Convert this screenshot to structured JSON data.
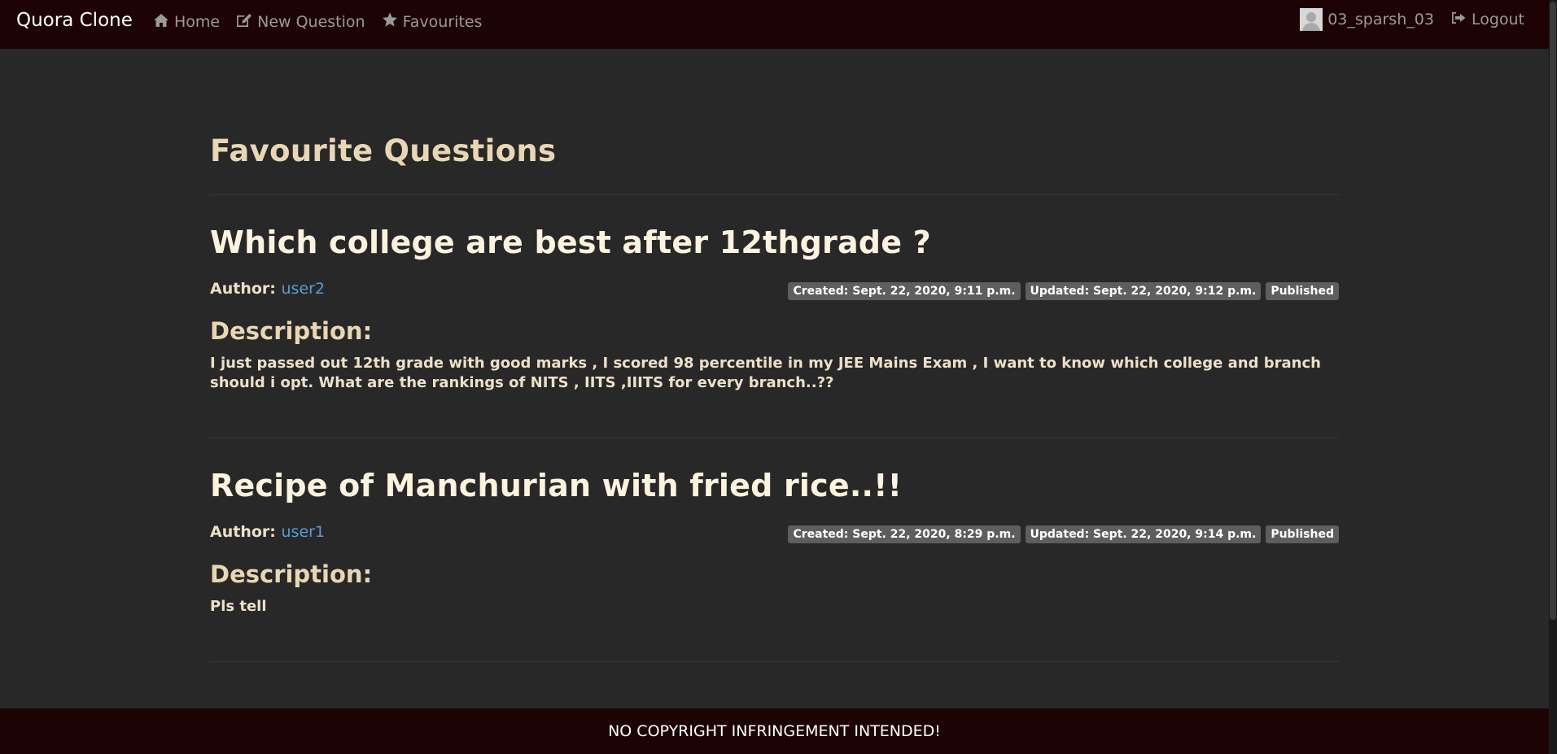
{
  "navbar": {
    "brand": "Quora Clone",
    "links": [
      {
        "label": "Home",
        "icon": "home-icon"
      },
      {
        "label": "New Question",
        "icon": "edit-icon"
      },
      {
        "label": "Favourites",
        "icon": "star-icon"
      }
    ],
    "username": "03_sparsh_03",
    "logout_label": "Logout"
  },
  "main": {
    "page_title": "Favourite Questions",
    "questions": [
      {
        "title": "Which college are best after 12thgrade ?",
        "author_label": "Author:",
        "author": "user2",
        "created": "Created: Sept. 22, 2020, 9:11 p.m.",
        "updated": "Updated: Sept. 22, 2020, 9:12 p.m.",
        "status": "Published",
        "description_heading": "Description:",
        "description": "I just passed out 12th grade with good marks , I scored 98 percentile in my JEE Mains Exam , I want to know which college and branch should i opt. What are the rankings of NITS , IITS ,IIITS for every branch..??"
      },
      {
        "title": "Recipe of Manchurian with fried rice..!!",
        "author_label": "Author:",
        "author": "user1",
        "created": "Created: Sept. 22, 2020, 8:29 p.m.",
        "updated": "Updated: Sept. 22, 2020, 9:14 p.m.",
        "status": "Published",
        "description_heading": "Description:",
        "description": "Pls tell"
      }
    ]
  },
  "footer": {
    "text": "NO COPYRIGHT INFRINGEMENT INTENDED!"
  }
}
